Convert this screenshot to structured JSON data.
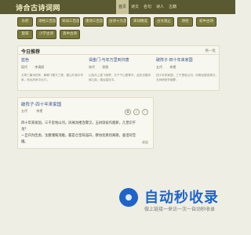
{
  "header": {
    "logo": "诗合古诗词网",
    "nav": [
      "首页",
      "诗文",
      "名句",
      "诗人",
      "古籍"
    ]
  },
  "tags": [
    "乐府",
    "诗经三百首",
    "宋词三百首",
    "唐诗三百首",
    "古诗十九首",
    "宋词精选",
    "古文观止",
    "诗经",
    "初中古诗",
    "楚辞",
    "小学古诗",
    "高中古诗"
  ],
  "recommend": {
    "title": "今日推荐",
    "more": "换一批",
    "items": [
      {
        "title": "蓝色",
        "dynasty": "现代",
        "author": "李清照",
        "body": "文章三篇诗的来，朝朝飞雪又三更。春山叶落中华家，西北风来中出门。"
      },
      {
        "title": "谒金门·与年万里到归唐",
        "dynasty": "宋代",
        "author": "徐照",
        "body": "山色月上香飞绮罗，天下千山更寒冷，此处也春风绿江南，楼台高处中。"
      },
      {
        "title": "破阵子·四十年来家国",
        "dynasty": "五代",
        "author": "李煜",
        "body": "四十年来家国，三千里地山河。凤阁龙楼连霄汉，玉树琼枝作烟萝。"
      }
    ]
  },
  "poem": {
    "title": "破阵子·四十年来家国",
    "dynasty": "五代",
    "author": "李煜",
    "lines": [
      "四十年来家国，三千里地山河。凤阁龙楼连霄汉，玉树琼枝作烟萝，几曾识干戈？",
      "一旦归为臣虏，沈腰潘鬓消磨。最是仓皇辞庙日，教坊犹奏别离歌，垂泪对宫娥。"
    ],
    "footer": "",
    "footer_right": "收起"
  },
  "watermark": {
    "title": "自动秒收录",
    "subtitle": "做上链接一来访一次一自动秒收录"
  },
  "colors": {
    "header_bg": "#5a5a32",
    "tag_bg": "#7b7a3d",
    "link": "#31558a",
    "watermark": "#1e63c9"
  }
}
